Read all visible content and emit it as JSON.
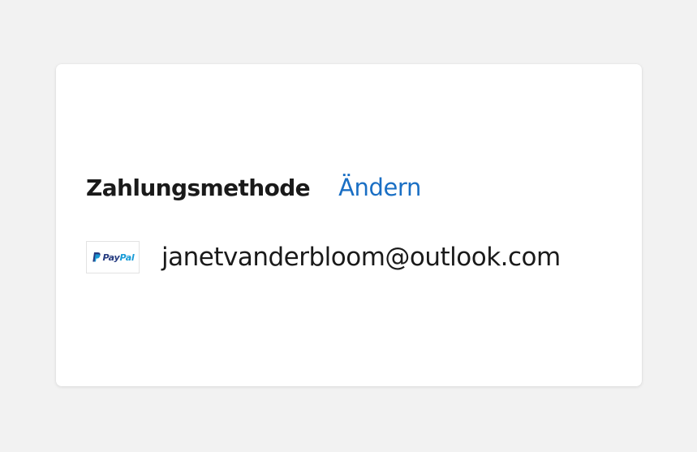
{
  "payment": {
    "title": "Zahlungsmethode",
    "change_label": "Ändern",
    "method": {
      "logo": {
        "icon": "paypal-icon",
        "word_pay": "Pay",
        "word_pal": "Pal",
        "colors": {
          "pay": "#253b80",
          "pal": "#179bd7"
        }
      },
      "account": "janetvanderbloom@outlook.com"
    }
  },
  "colors": {
    "background": "#f2f2f2",
    "card": "#ffffff",
    "text": "#1a1a1a",
    "link": "#1a6fc4"
  }
}
